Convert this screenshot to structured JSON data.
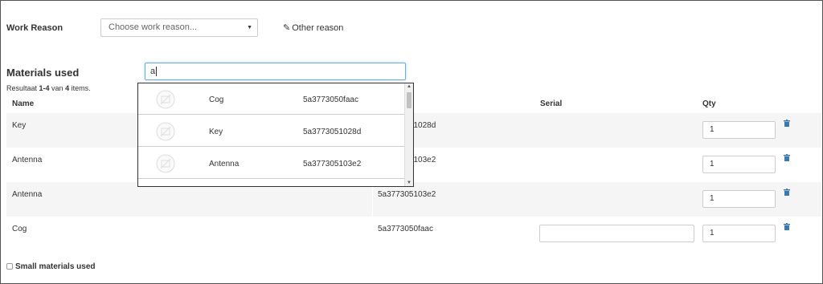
{
  "work_reason": {
    "label": "Work Reason",
    "select_value": "Choose work reason...",
    "other_reason_label": "Other reason"
  },
  "materials": {
    "title": "Materials used",
    "search_value": "a",
    "result_prefix": "Resultaat ",
    "result_range": "1-4",
    "result_mid": " van ",
    "result_total": "4",
    "result_suffix": " items.",
    "columns": {
      "name": "Name",
      "serial": "Serial",
      "qty": "Qty"
    },
    "rows": [
      {
        "name": "Key",
        "code": "5a3773051028d",
        "qty": "1"
      },
      {
        "name": "Antenna",
        "code": "5a377305103e2",
        "qty": "1"
      },
      {
        "name": "Antenna",
        "code": "5a377305103e2",
        "qty": "1"
      },
      {
        "name": "Cog",
        "code": "5a3773050faac",
        "qty": "1"
      }
    ],
    "small_materials_label": "Small materials used"
  },
  "dropdown": {
    "items": [
      {
        "name": "Cog",
        "code": "5a3773050faac"
      },
      {
        "name": "Key",
        "code": "5a3773051028d"
      },
      {
        "name": "Antenna",
        "code": "5a377305103e2"
      }
    ]
  },
  "colors": {
    "accent": "#337ab7",
    "focus": "#66afe9",
    "row_stripe": "#f5f5f5"
  },
  "icons": {
    "pencil": "pencil-icon",
    "trash": "trash-icon",
    "caret": "caret-down-icon",
    "image": "no-image-icon"
  }
}
